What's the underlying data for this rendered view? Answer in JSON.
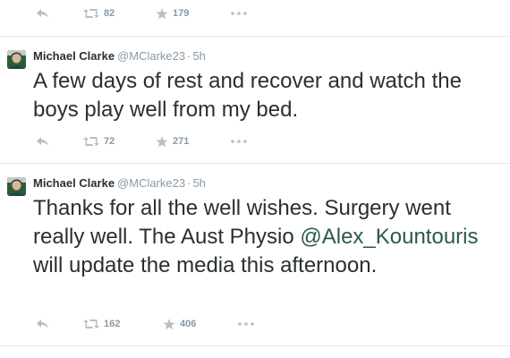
{
  "tweets": [
    {
      "partial": true,
      "retweets": "82",
      "favorites": "179"
    },
    {
      "name": "Michael Clarke",
      "handle": "@MClarke23",
      "sep": "·",
      "time": "5h",
      "text_parts": [
        "A few days of rest and recover and watch the boys play well from my bed."
      ],
      "retweets": "72",
      "favorites": "271"
    },
    {
      "name": "Michael Clarke",
      "handle": "@MClarke23",
      "sep": "·",
      "time": "5h",
      "text_before": "Thanks for all the well wishes. Surgery went really well. The Aust Physio ",
      "mention": "@Alex_Kountouris",
      "text_after": " will update the media this afternoon.",
      "retweets": "162",
      "favorites": "406"
    }
  ],
  "icons": {
    "reply": "reply-icon",
    "retweet": "retweet-icon",
    "favorite": "star-icon",
    "more": "more-icon"
  },
  "colors": {
    "text": "#292f33",
    "meta": "#8899a6",
    "action": "#a6b1ba",
    "mention": "#2b5a45",
    "divider": "#e1e8ed"
  }
}
